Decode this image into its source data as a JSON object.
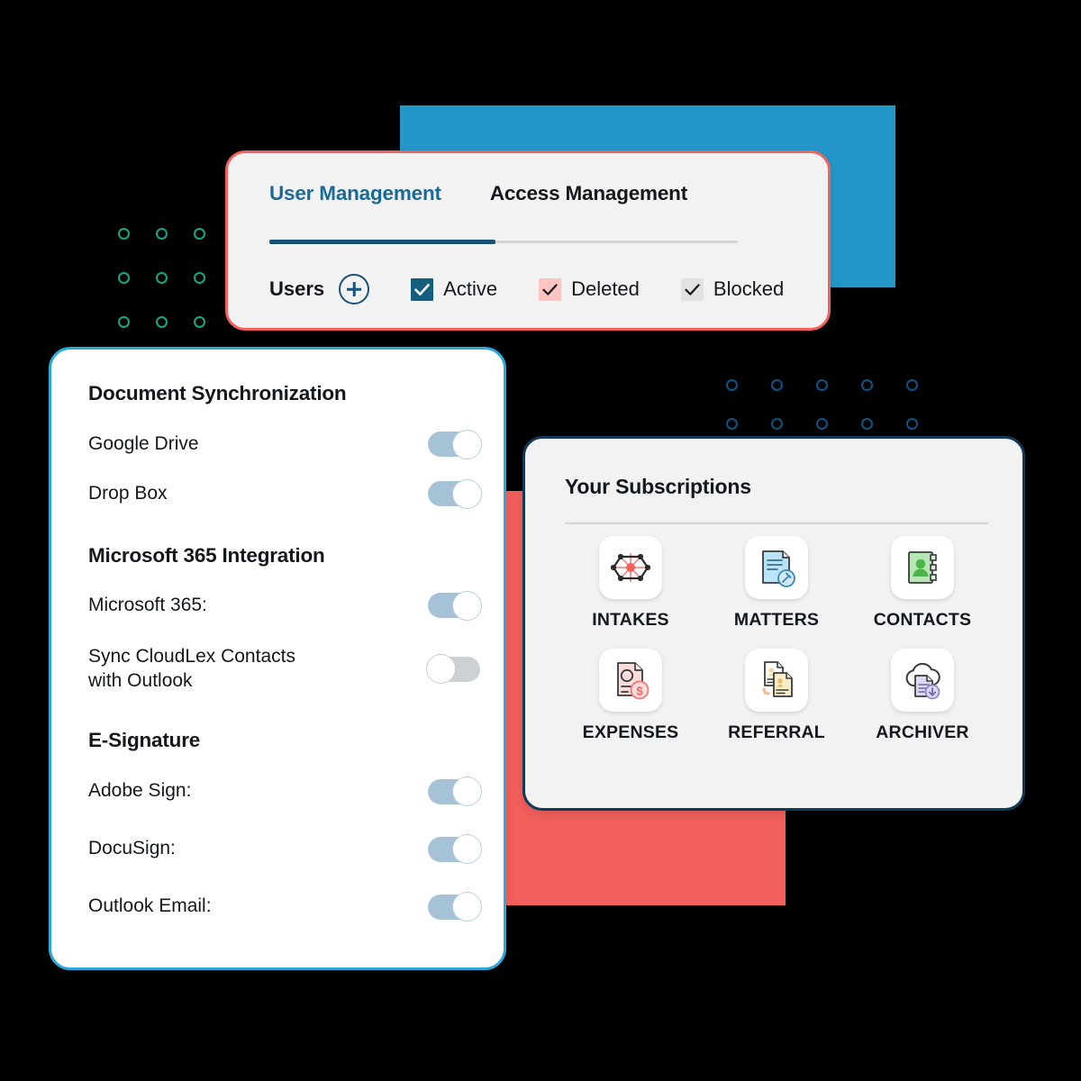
{
  "colors": {
    "bg": "#000000",
    "blue_block": "#2496c8",
    "red_block": "#f4605c",
    "tab_active": "#1b6a96",
    "tab_underline_active": "#17527a",
    "card_users_border": "#f4605c",
    "card_settings_border": "#29a8dc",
    "card_subs_border": "#123a56",
    "toggle_on": "#a6c2d6",
    "toggle_off": "#cdd1d4",
    "dots_left": "#13a884",
    "dots_right": "#0d5384",
    "checkbox_active_fill": "#145f80",
    "checkbox_deleted_fill": "#ffc4c0",
    "checkbox_blocked_fill": "#e2e2e2"
  },
  "user_management_card": {
    "tabs": [
      {
        "label": "User Management",
        "active": true
      },
      {
        "label": "Access Management",
        "active": false
      }
    ],
    "users_label": "Users",
    "add_button_icon": "plus-circle-icon",
    "filters": [
      {
        "label": "Active",
        "checked": true,
        "style": "filled-dark"
      },
      {
        "label": "Deleted",
        "checked": true,
        "style": "filled-pink"
      },
      {
        "label": "Blocked",
        "checked": true,
        "style": "filled-gray"
      }
    ]
  },
  "settings_card": {
    "sections": [
      {
        "title": "Document Synchronization",
        "rows": [
          {
            "label": "Google Drive",
            "toggle": "on"
          },
          {
            "label": "Drop Box",
            "toggle": "on"
          }
        ]
      },
      {
        "title": "Microsoft 365 Integration",
        "rows": [
          {
            "label": "Microsoft 365:",
            "toggle": "on"
          },
          {
            "label": "Sync CloudLex Contacts with Outlook",
            "toggle": "off"
          }
        ]
      },
      {
        "title": "E-Signature",
        "rows": [
          {
            "label": "Adobe Sign:",
            "toggle": "on"
          },
          {
            "label": "DocuSign:",
            "toggle": "on"
          },
          {
            "label": "Outlook Email:",
            "toggle": "on"
          }
        ]
      }
    ]
  },
  "subscriptions_card": {
    "title": "Your Subscriptions",
    "items": [
      {
        "name": "INTAKES",
        "icon": "network-hexagon-icon"
      },
      {
        "name": "MATTERS",
        "icon": "document-gavel-icon"
      },
      {
        "name": "CONTACTS",
        "icon": "address-book-person-icon"
      },
      {
        "name": "EXPENSES",
        "icon": "invoice-dollar-icon"
      },
      {
        "name": "REFERRAL",
        "icon": "two-person-documents-icon"
      },
      {
        "name": "ARCHIVER",
        "icon": "cloud-document-download-icon"
      }
    ]
  }
}
